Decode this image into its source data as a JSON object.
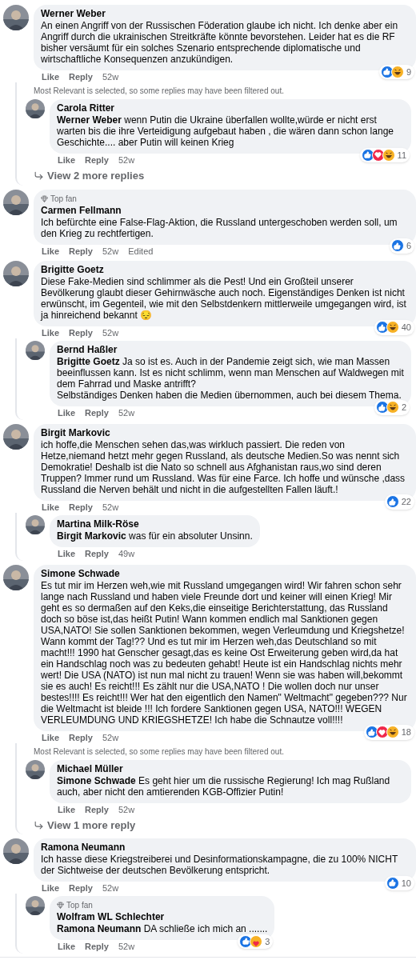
{
  "comments": [
    {
      "author": "Werner Weber",
      "text": "An einen Angriff von der Russischen Föderation glaube ich nicht. Ich denke aber ein Angriff durch die ukrainischen Streitkräfte könnte bevorstehen. Leider hat es die RF bisher versäumt für ein solches Szenario entsprechende diplomatische und wirtschaftliche Konsequenzen anzukündigen.",
      "actions": {
        "like": "Like",
        "reply": "Reply",
        "time": "52w"
      },
      "reactions": [
        {
          "kind": "like"
        },
        {
          "kind": "haha"
        }
      ],
      "reaction_count": "9",
      "filter_note": "Most Relevant is selected, so some replies may have been filtered out.",
      "replies": [
        {
          "author": "Carola Ritter",
          "text": "**Werner Weber** wenn Putin die Ukraine überfallen wollte,würde er nicht erst warten bis die ihre Verteidigung aufgebaut haben , die wären dann schon lange Geschichte.... aber Putin will keinen Krieg",
          "actions": {
            "like": "Like",
            "reply": "Reply",
            "time": "52w"
          },
          "reactions": [
            {
              "kind": "like"
            },
            {
              "kind": "love"
            },
            {
              "kind": "haha"
            }
          ],
          "reaction_count": "11"
        }
      ],
      "more_replies": "View 2 more replies"
    },
    {
      "badge": "Top fan",
      "author": "Carmen Fellmann",
      "text": "Ich befürchte eine False-Flag-Aktion, die Russland untergeschoben werden soll, um den Krieg zu rechtfertigen.",
      "actions": {
        "like": "Like",
        "reply": "Reply",
        "time": "52w",
        "edited": "Edited"
      },
      "reactions": [
        {
          "kind": "like"
        }
      ],
      "reaction_count": "6"
    },
    {
      "author": "Brigitte Goetz",
      "text": "Diese Fake-Medien sind schlimmer als die Pest! Und ein Großteil unserer Bevölkerung glaubt dieser Gehirnwäsche auch noch. Eigenständiges Denken ist nicht erwünscht, im Gegenteil, wie mit den Selbstdenkern mittlerweile umgegangen wird, ist ja hinreichend bekannt 😔",
      "actions": {
        "like": "Like",
        "reply": "Reply",
        "time": "52w"
      },
      "reactions": [
        {
          "kind": "like"
        },
        {
          "kind": "haha"
        }
      ],
      "reaction_count": "40",
      "replies": [
        {
          "author": "Bernd Haßler",
          "text": "**Brigitte Goetz** Ja so ist es. Auch in der Pandemie zeigt sich, wie man Massen beeinflussen kann. Ist es nicht schlimm, wenn man Menschen auf Waldwegen mit dem Fahrrad und Maske antrifft?\nSelbständiges Denken haben die Medien übernommen, auch bei diesem Thema.",
          "actions": {
            "like": "Like",
            "reply": "Reply",
            "time": "52w"
          },
          "reactions": [
            {
              "kind": "like"
            },
            {
              "kind": "haha"
            }
          ],
          "reaction_count": "2"
        }
      ]
    },
    {
      "author": "Birgit Markovic",
      "text": "ich hoffe,die Menschen sehen das,was wirkluch passiert. Die reden von Hetze,niemand hetzt mehr gegen Russland, als deutsche Medien.So was nennt sich Demokratie! Deshalb ist die Nato so schnell aus Afghanistan raus,wo sind deren Truppen? Immer rund um Russland. Was für eine Farce. Ich hoffe und wünsche ,dass Russland die Nerven behält und nicht in die aufgestellten Fallen läuft.!",
      "actions": {
        "like": "Like",
        "reply": "Reply",
        "time": "52w"
      },
      "reactions": [
        {
          "kind": "like"
        }
      ],
      "reaction_count": "22",
      "replies": [
        {
          "author": "Martina Milk-Röse",
          "text": "**Birgit Markovic** was für ein absoluter Unsinn.",
          "actions": {
            "like": "Like",
            "reply": "Reply",
            "time": "49w"
          }
        }
      ]
    },
    {
      "author": "Simone Schwade",
      "text": "Es tut mir im Herzen weh,wie mit Russland umgegangen wird! Wir fahren schon sehr lange nach Russland und haben viele Freunde dort und keiner will einen Krieg! Mir geht es so dermaßen auf den Keks,die einseitige Berichterstattung, das Russland doch so böse ist,das heißt Putin! Wann kommen endlich mal Sanktionen gegen USA,NATO! Sie sollen Sanktionen bekommen, wegen Verleumdung und Kriegshetze! Wann kommt der Tag!?? Und es tut mir im Herzen weh,das Deutschland so mit macht!!! 1990 hat Genscher gesagt,das es keine Ost Erweiterung geben wird,da hat ein Handschlag noch was zu bedeuten gehabt! Heute ist ein Handschlag nichts mehr wert! Die USA (NATO) ist nun mal nicht zu trauen! Wenn sie was haben will,bekommt sie es auch! Es reicht!!! Es zählt nur die USA,NATO ! Die wollen doch nur unser bestes!!!! Es reicht!!! Wer hat den eigentlich den Namen\" Weltmacht\" gegeben??? Nur die Weltmacht ist bleide !!! Ich fordere Sanktionen gegen USA, NATO!!! WEGEN VERLEUMDUNG UND KRIEGSHETZE! Ich habe die Schnautze voll!!!!",
      "actions": {
        "like": "Like",
        "reply": "Reply",
        "time": "52w"
      },
      "reactions": [
        {
          "kind": "like"
        },
        {
          "kind": "love"
        },
        {
          "kind": "haha"
        }
      ],
      "reaction_count": "18",
      "filter_note": "Most Relevant is selected, so some replies may have been filtered out.",
      "replies": [
        {
          "author": "Michael Müller",
          "text": "**Simone Schwade** Es geht hier um die russische Regierung! Ich mag Rußland auch, aber nicht den amtierenden KGB-Offizier Putin!",
          "actions": {
            "like": "Like",
            "reply": "Reply",
            "time": "52w"
          }
        }
      ],
      "more_replies": "View 1 more reply"
    },
    {
      "author": "Ramona Neumann",
      "text": "Ich hasse diese Kriegstreiberei und Desinformationskampagne, die zu 100% NICHT der Sichtweise der deutschen Bevölkerung entspricht.",
      "actions": {
        "like": "Like",
        "reply": "Reply",
        "time": "52w"
      },
      "reactions": [
        {
          "kind": "like"
        }
      ],
      "reaction_count": "10",
      "replies": [
        {
          "badge": "Top fan",
          "author": "Wolfram WL Schlechter",
          "text": "**Ramona Neumann** DA schließe ich mich an .......",
          "actions": {
            "like": "Like",
            "reply": "Reply",
            "time": "52w"
          },
          "reactions": [
            {
              "kind": "like"
            },
            {
              "kind": "care"
            }
          ],
          "reaction_count": "3"
        }
      ]
    }
  ]
}
